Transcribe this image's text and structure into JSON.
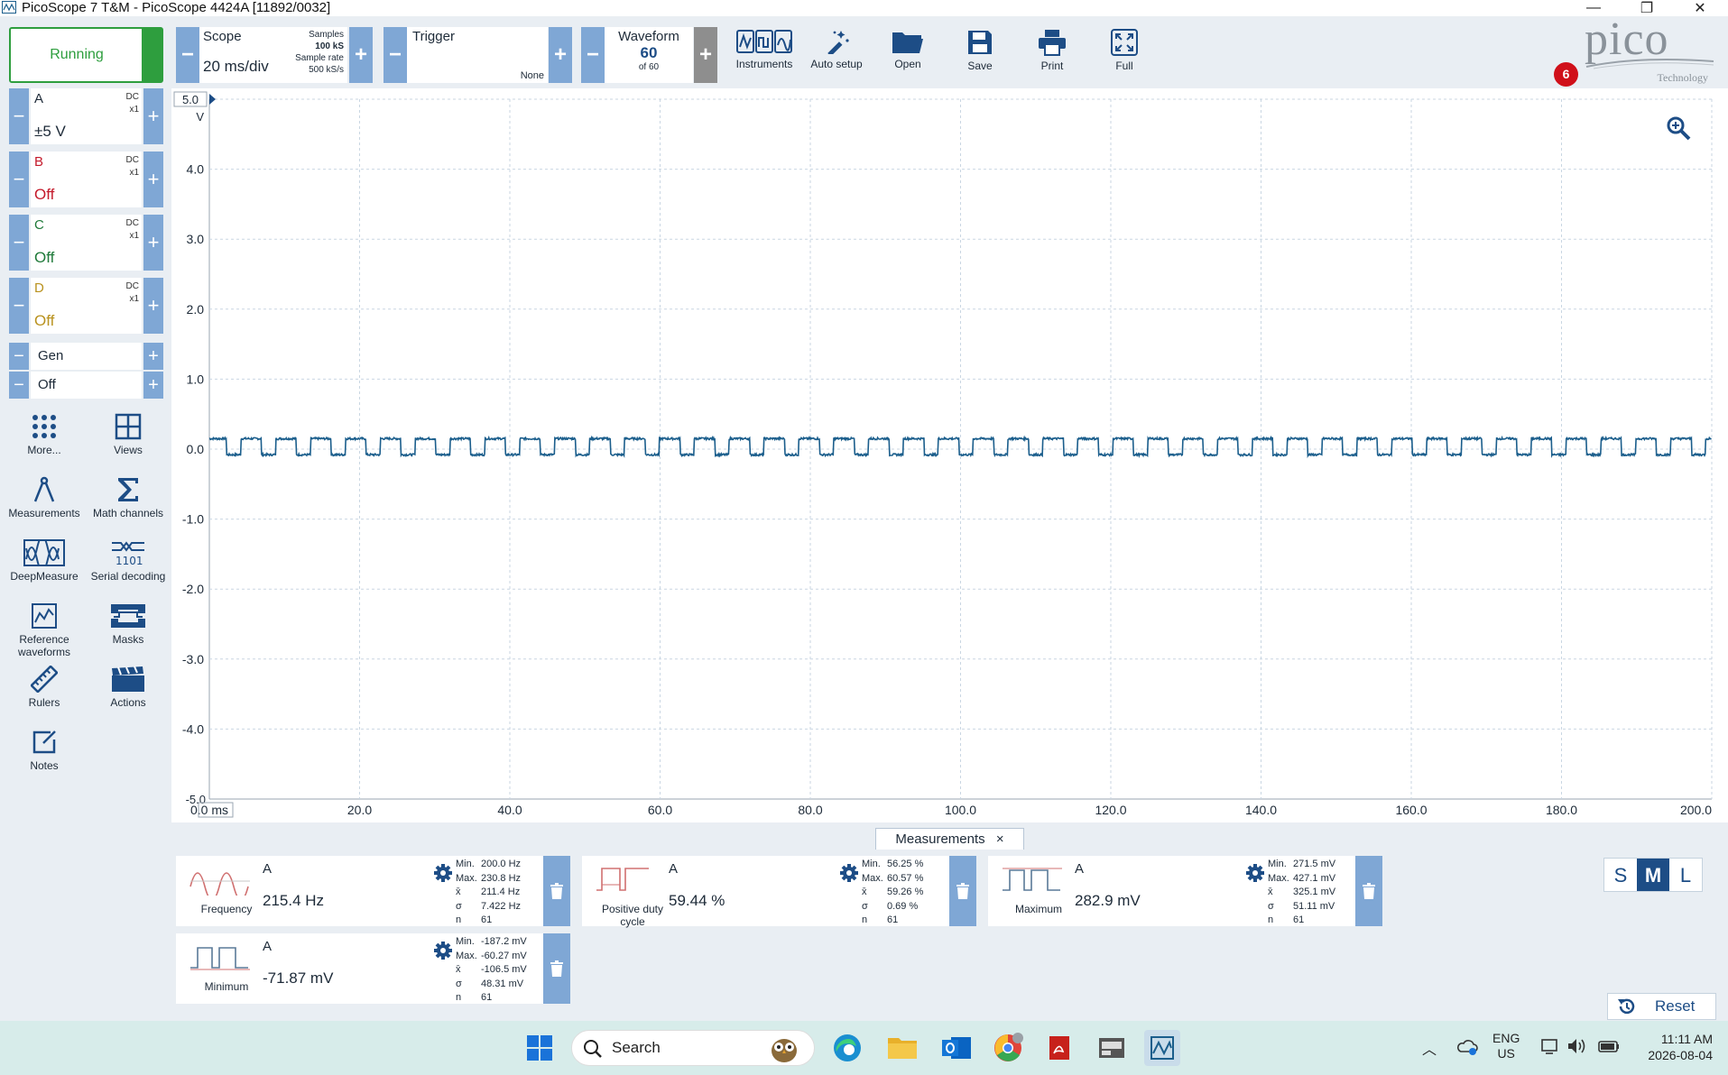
{
  "window": {
    "title": "PicoScope 7 T&M  - PicoScope 4424A [11892/0032]",
    "minimize": "—",
    "restore": "❐",
    "close": "✕"
  },
  "toolbar": {
    "run_label": "Running",
    "scope": {
      "label": "Scope",
      "timebase": "20 ms/div",
      "samples_label": "Samples",
      "samples": "100 kS",
      "rate_label": "Sample rate",
      "rate": "500 kS/s"
    },
    "trigger": {
      "label": "Trigger",
      "mode": "None"
    },
    "waveform": {
      "label": "Waveform",
      "current": "60",
      "of": "of 60"
    },
    "buttons": {
      "instruments": "Instruments",
      "auto_setup": "Auto setup",
      "open": "Open",
      "save": "Save",
      "print": "Print",
      "full": "Full"
    },
    "logo_text": "pico",
    "logo_sub": "Technology",
    "notifications": "6"
  },
  "channels": [
    {
      "name": "A",
      "coupling": "DC",
      "probe": "x1",
      "range": "±5 V",
      "color": "#1d2a38"
    },
    {
      "name": "B",
      "coupling": "DC",
      "probe": "x1",
      "range": "Off",
      "color": "#c41a2b"
    },
    {
      "name": "C",
      "coupling": "DC",
      "probe": "x1",
      "range": "Off",
      "color": "#1f7a3a"
    },
    {
      "name": "D",
      "coupling": "DC",
      "probe": "x1",
      "range": "Off",
      "color": "#b9921f"
    }
  ],
  "generator": {
    "label": "Gen",
    "state": "Off"
  },
  "tools": {
    "more": "More...",
    "views": "Views",
    "measurements": "Measurements",
    "math": "Math channels",
    "deepmeasure": "DeepMeasure",
    "serial": "Serial decoding",
    "reference_l1": "Reference",
    "reference_l2": "waveforms",
    "masks": "Masks",
    "rulers": "Rulers",
    "actions": "Actions",
    "notes": "Notes"
  },
  "plot": {
    "y_unit": "V",
    "y_top_label": "5.0",
    "y_bottom_label": "-5.0",
    "x_unit_suffix": "ms",
    "y_ticks": [
      "4.0",
      "3.0",
      "2.0",
      "1.0",
      "0.0",
      "-1.0",
      "-2.0",
      "-3.0",
      "-4.0"
    ],
    "x_ticks": [
      "0.0",
      "20.0",
      "40.0",
      "60.0",
      "80.0",
      "100.0",
      "120.0",
      "140.0",
      "160.0",
      "180.0",
      "200.0"
    ],
    "trace_color": "#1b5e8c"
  },
  "chart_data": {
    "type": "line",
    "title": "",
    "xlabel": "ms",
    "ylabel": "V",
    "xlim": [
      0,
      200
    ],
    "ylim": [
      -5,
      5
    ],
    "grid": true,
    "series": [
      {
        "values_description_free": true,
        "frequency_hz": 215.4,
        "high_v": 0.15,
        "low_v": -0.08,
        "duty_percent": 59.44
      }
    ]
  },
  "measurements": {
    "tab_label": "Measurements",
    "tab_close": "×",
    "items": [
      {
        "name": "Frequency",
        "name2": "",
        "channel": "A",
        "value": "215.4 Hz",
        "min": "200.0 Hz",
        "max": "230.8 Hz",
        "mean": "211.4 Hz",
        "sigma": "7.422 Hz",
        "n": "61"
      },
      {
        "name": "Positive duty",
        "name2": "cycle",
        "channel": "A",
        "value": "59.44 %",
        "min": "56.25 %",
        "max": "60.57 %",
        "mean": "59.26 %",
        "sigma": "0.69 %",
        "n": "61"
      },
      {
        "name": "Maximum",
        "name2": "",
        "channel": "A",
        "value": "282.9 mV",
        "min": "271.5 mV",
        "max": "427.1 mV",
        "mean": "325.1 mV",
        "sigma": "51.11 mV",
        "n": "61"
      },
      {
        "name": "Minimum",
        "name2": "",
        "channel": "A",
        "value": "-71.87 mV",
        "min": "-187.2 mV",
        "max": "-60.27 mV",
        "mean": "-106.5 mV",
        "sigma": "48.31 mV",
        "n": "61"
      }
    ],
    "stat_labels": {
      "min": "Min.",
      "max": "Max.",
      "mean": "x̄",
      "sigma": "σ",
      "n": "n"
    },
    "size": {
      "s": "S",
      "m": "M",
      "l": "L"
    },
    "reset": "Reset"
  },
  "taskbar": {
    "search": "Search",
    "lang1": "ENG",
    "lang2": "US",
    "time": "11:11 AM",
    "date": "2026-08-04"
  }
}
